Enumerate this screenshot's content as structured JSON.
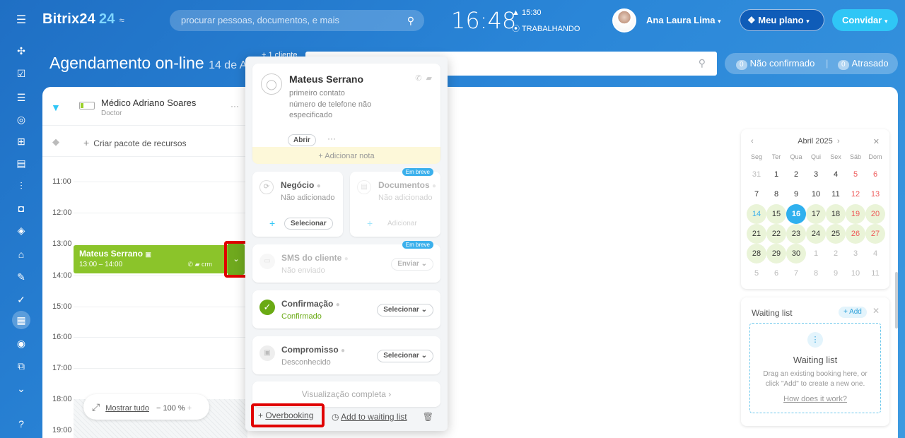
{
  "header": {
    "logo_name": "Bitrix24",
    "logo_number": "24",
    "search_placeholder": "procurar pessoas, documentos, e mais",
    "clock": "16:48",
    "work_time": "15:30",
    "work_status": "TRABALHANDO",
    "user_name": "Ana Laura Lima",
    "plan_label": "Meu plano",
    "invite_label": "Convidar"
  },
  "page": {
    "title": "Agendamento on-line",
    "date_partial": "14 de Ab",
    "client_count_partial": "+ 1 cliente",
    "badge_unconfirmed_count": "0",
    "badge_unconfirmed_label": "Não confirmado",
    "badge_late_count": "0",
    "badge_late_label": "Atrasado"
  },
  "resource": {
    "name": "Médico Adriano Soares",
    "role": "Doctor",
    "create_package": "Criar pacote de recursos"
  },
  "timeline": {
    "hours": [
      "11:00",
      "12:00",
      "13:00",
      "14:00",
      "15:00",
      "16:00",
      "17:00",
      "18:00",
      "19:00"
    ]
  },
  "booking": {
    "client": "Mateus Serrano",
    "time": "13:00 – 14:00",
    "extra": "crm"
  },
  "zoom": {
    "show_all": "Mostrar tudo",
    "percent": "100 %"
  },
  "popup": {
    "client_name": "Mateus Serrano",
    "client_status": "primeiro contato",
    "client_phone": "número de telefone não especificado",
    "open_label": "Abrir",
    "add_note": "+ Adicionar nota",
    "deal_title": "Negócio",
    "deal_status": "Não adicionado",
    "deal_select": "Selecionar",
    "docs_title": "Documentos",
    "docs_status": "Não adicionado",
    "docs_add": "Adicionar",
    "soon_label": "Em breve",
    "sms_title": "SMS do cliente",
    "sms_status": "Não enviado",
    "sms_send": "Enviar",
    "confirm_title": "Confirmação",
    "confirm_status": "Confirmado",
    "confirm_select": "Selecionar",
    "visit_title": "Compromisso",
    "visit_status": "Desconhecido",
    "visit_select": "Selecionar",
    "full_view": "Visualização completa",
    "overbooking": "Overbooking",
    "waiting_add": "Add to waiting list"
  },
  "calendar": {
    "month": "Abril 2025",
    "weekdays": [
      "Seg",
      "Ter",
      "Qua",
      "Qui",
      "Sex",
      "Sáb",
      "Dom"
    ],
    "days": [
      "31",
      "1",
      "2",
      "3",
      "4",
      "5",
      "6",
      "7",
      "8",
      "9",
      "10",
      "11",
      "12",
      "13",
      "14",
      "15",
      "16",
      "17",
      "18",
      "19",
      "20",
      "21",
      "22",
      "23",
      "24",
      "25",
      "26",
      "27",
      "28",
      "29",
      "30",
      "1",
      "2",
      "3",
      "4",
      "5",
      "6",
      "7",
      "8",
      "9",
      "10",
      "11"
    ],
    "selected_day": "16"
  },
  "waiting": {
    "title": "Waiting list",
    "add_label": "+ Add",
    "heading": "Waiting list",
    "description": "Drag an existing booking here, or click \"Add\" to create a new one.",
    "link": "How does it work?"
  },
  "colors": {
    "accent": "#2fc6f6",
    "booking_green": "#8bc42a",
    "highlight_red": "#e00000",
    "selected_day": "#2fb0ee"
  }
}
